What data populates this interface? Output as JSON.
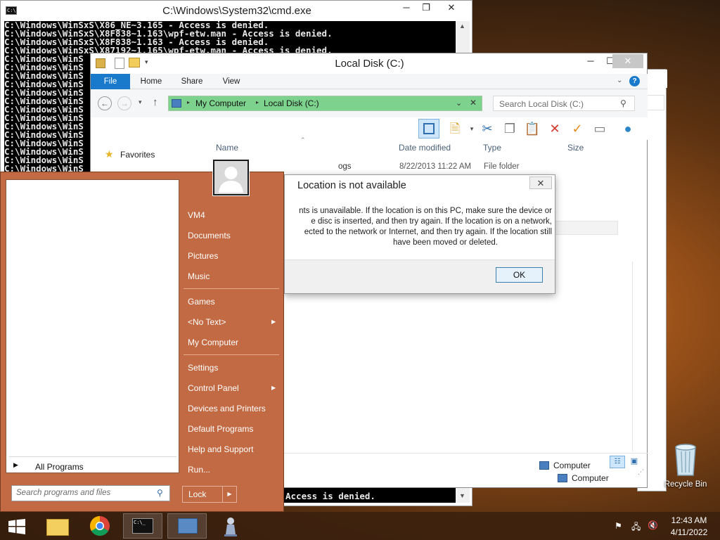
{
  "cmd": {
    "title": "C:\\Windows\\System32\\cmd.exe",
    "lines": [
      "C:\\Windows\\WinSxS\\X86_NE~3.165 - Access is denied.",
      "C:\\Windows\\WinSxS\\X8F838~1.163\\wpf-etw.man - Access is denied.",
      "C:\\Windows\\WinSxS\\X8F838~1.163 - Access is denied.",
      "C:\\Windows\\WinSxS\\X87192~1.165\\wpf-etw.man - Access is denied.",
      "C:\\Windows\\WinS",
      "C:\\Windows\\WinS",
      "C:\\Windows\\WinS",
      "C:\\Windows\\WinS",
      "C:\\Windows\\WinS",
      "C:\\Windows\\WinS",
      "C:\\Windows\\WinS",
      "C:\\Windows\\WinS",
      "C:\\Windows\\WinS",
      "C:\\Windows\\WinS",
      "C:\\Windows\\WinS",
      "C:\\Windows\\WinS",
      "C:\\Windows\\WinS",
      "C:\\Windows\\WinS"
    ],
    "bottom_line": "Access is denied.",
    "min_label": "─",
    "max_label": "❐",
    "close_label": "✕"
  },
  "explorer": {
    "title": "Local Disk (C:)",
    "tabs": {
      "file": "File",
      "home": "Home",
      "share": "Share",
      "view": "View"
    },
    "breadcrumb": [
      "My Computer",
      "Local Disk (C:)"
    ],
    "search_placeholder": "Search Local Disk (C:)",
    "nav_favorites": "Favorites",
    "columns": {
      "name": "Name",
      "date": "Date modified",
      "type": "Type",
      "size": "Size"
    },
    "rows": [
      {
        "name": "ogs",
        "date": "8/22/2013 11:22 AM",
        "type": "File folder"
      }
    ],
    "status_location": "Computer",
    "status_location2": "Computer"
  },
  "dialog": {
    "title": "Location is not available",
    "message_lines": [
      "nts is unavailable. If the location is on this PC, make sure the device or",
      "e disc is inserted, and then try again. If the location is on a network,",
      "ected to the network or Internet, and then try again. If the location still",
      "have been moved or deleted."
    ],
    "ok_label": "OK",
    "close_label": "✕"
  },
  "startmenu": {
    "all_programs": "All Programs",
    "search_placeholder": "Search programs and files",
    "items": [
      {
        "label": "VM4",
        "arrow": false
      },
      {
        "label": "Documents",
        "arrow": false
      },
      {
        "label": "Pictures",
        "arrow": false
      },
      {
        "label": "Music",
        "arrow": false
      },
      {
        "label": "Games",
        "arrow": false
      },
      {
        "label": "<No Text>",
        "arrow": true
      },
      {
        "label": "My Computer",
        "arrow": false
      },
      {
        "label": "Settings",
        "arrow": false
      },
      {
        "label": "Control Panel",
        "arrow": true
      },
      {
        "label": "Devices and Printers",
        "arrow": false
      },
      {
        "label": "Default Programs",
        "arrow": false
      },
      {
        "label": "Help and Support",
        "arrow": false
      },
      {
        "label": "Run...",
        "arrow": false
      }
    ],
    "lock_label": "Lock"
  },
  "desktop": {
    "recycle_bin_label": "Recycle Bin"
  },
  "taskbar": {
    "time": "12:43 AM",
    "date": "4/11/2022"
  },
  "colors": {
    "accent": "#1979ca",
    "startmenu_bg": "#c26a43",
    "address_bar": "#7dd38d"
  }
}
